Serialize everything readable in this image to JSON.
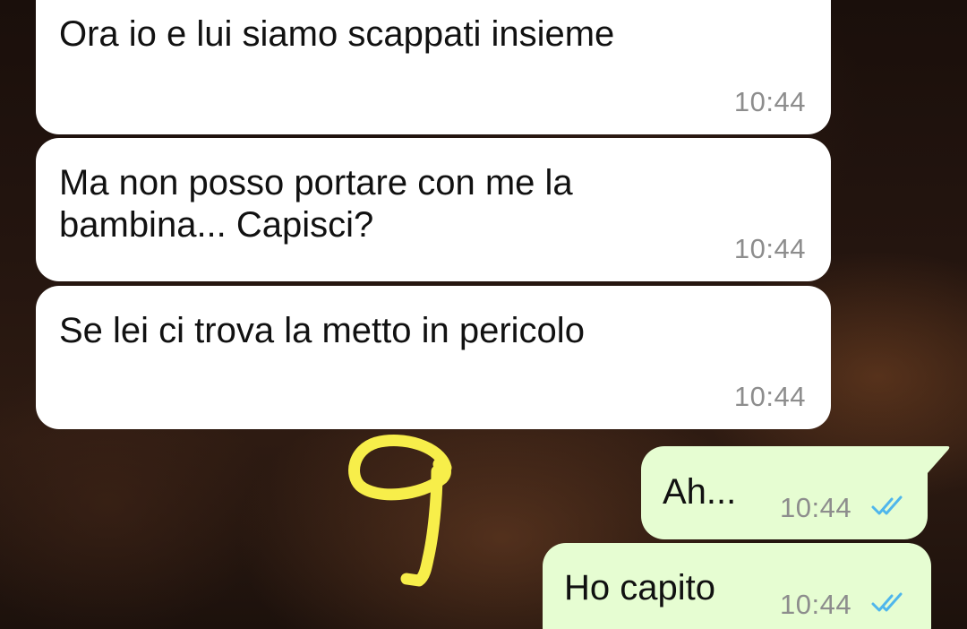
{
  "messages": [
    {
      "direction": "incoming",
      "text": "Ora io e lui siamo scappati insieme",
      "time": "10:44"
    },
    {
      "direction": "incoming",
      "text": "Ma non posso portare con me la\nbambina... Capisci?",
      "time": "10:44"
    },
    {
      "direction": "incoming",
      "text": "Se lei ci trova la metto in pericolo",
      "time": "10:44"
    },
    {
      "direction": "outgoing",
      "text": "Ah...",
      "time": "10:44",
      "status": "read"
    },
    {
      "direction": "outgoing",
      "text": "Ho capito",
      "time": "10:44",
      "status": "read"
    }
  ],
  "colors": {
    "incoming_bubble": "#ffffff",
    "outgoing_bubble": "#e6fdd2",
    "read_ticks": "#4fb6ec",
    "timestamp": "#8d8d8d",
    "annotation": "#f7ee4a"
  },
  "icons": {
    "read_status": "double-check-icon"
  },
  "annotation": {
    "symbol": "hand-drawn-nine",
    "color": "#f7ee4a"
  }
}
